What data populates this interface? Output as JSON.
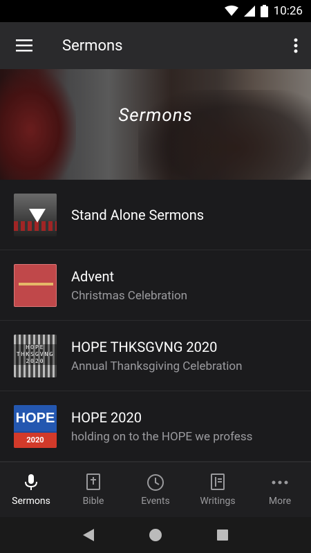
{
  "status_bar": {
    "time": "10:26"
  },
  "app_bar": {
    "title": "Sermons"
  },
  "banner": {
    "title": "Sermons"
  },
  "list": [
    {
      "title": "Stand Alone Sermons",
      "subtitle": ""
    },
    {
      "title": "Advent",
      "subtitle": "Christmas Celebration"
    },
    {
      "title": "HOPE THKSGVNG 2020",
      "subtitle": "Annual Thanksgiving Celebration"
    },
    {
      "title": "HOPE 2020",
      "subtitle": "holding on to the HOPE we profess"
    }
  ],
  "thumbnails": {
    "hope_thksgvng_text": "HOPE THKSGVNG 2020",
    "hope_text": "HOPE",
    "hope_year": "2020"
  },
  "bottom_nav": [
    {
      "label": "Sermons",
      "icon": "microphone-icon",
      "active": true
    },
    {
      "label": "Bible",
      "icon": "bible-icon",
      "active": false
    },
    {
      "label": "Events",
      "icon": "clock-icon",
      "active": false
    },
    {
      "label": "Writings",
      "icon": "book-icon",
      "active": false
    },
    {
      "label": "More",
      "icon": "more-horizontal-icon",
      "active": false
    }
  ]
}
